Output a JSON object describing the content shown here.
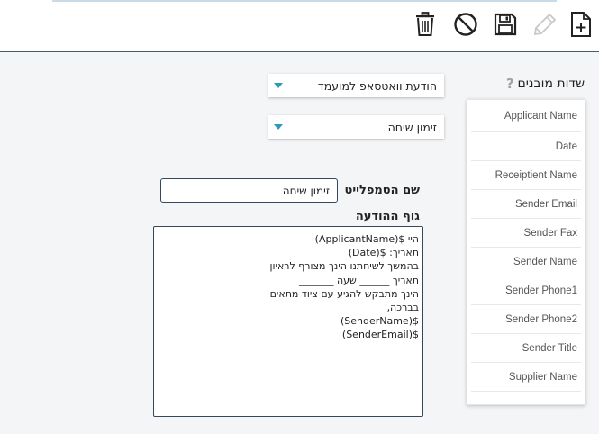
{
  "toolbar": {
    "icons": [
      "new-document-icon",
      "edit-pencil-icon",
      "save-icon",
      "cancel-icon",
      "trash-icon"
    ]
  },
  "fields": {
    "title": "שדות מובנים",
    "help": "?",
    "items": [
      "Applicant Name",
      "Date",
      "Receiptient Name",
      "Sender Email",
      "Sender Fax",
      "Sender Name",
      "Sender Phone1",
      "Sender Phone2",
      "Sender Title",
      "Supplier Name"
    ]
  },
  "form": {
    "message_type": "הודעת וואטסאפ למועמד",
    "template_type": "זימון שיחה",
    "template_name_label": "שם הטמפלייט",
    "template_name_value": "זימון שיחה",
    "body_label": "גוף ההודעה",
    "body_lines": [
      "היי $(ApplicantName)",
      "תאריך: $(Date)",
      "בהמשך לשיחתנו הינך מצורף לראיון",
      "תאריך ______ שעה _______",
      "הינך מתבקש להגיע עם ציוד מתאים",
      "בברכה,",
      "$(SenderName)",
      "$(SenderEmail)"
    ]
  },
  "colors": {
    "accent": "#2c9bb8",
    "border_dark": "#34495e",
    "background": "#f4f5f6"
  }
}
